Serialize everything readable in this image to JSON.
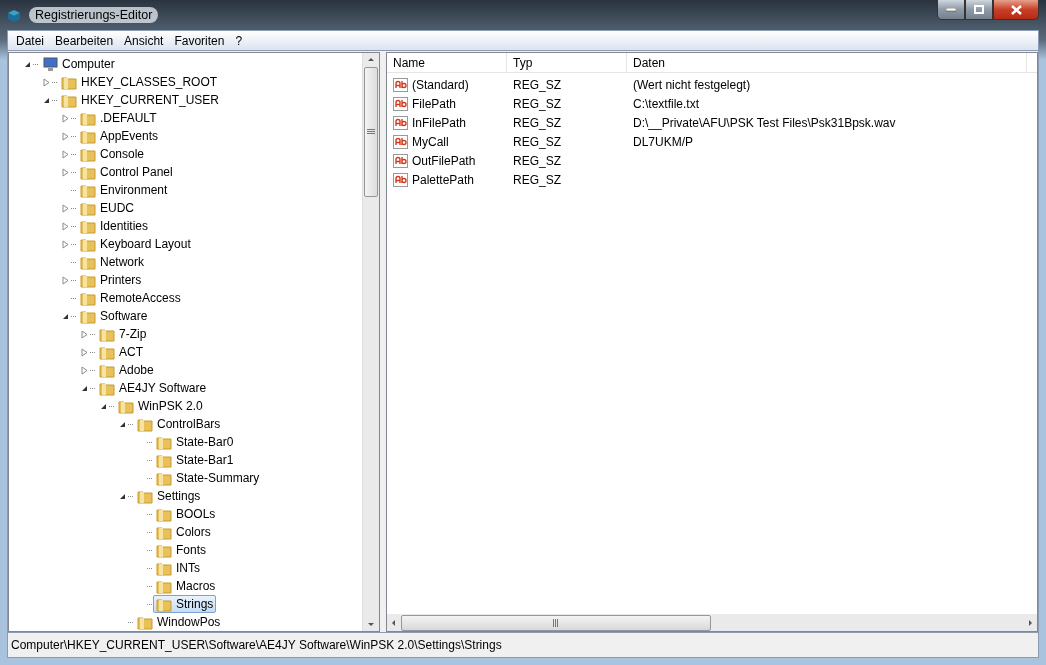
{
  "window": {
    "title": "Registrierungs-Editor"
  },
  "menu": [
    "Datei",
    "Bearbeiten",
    "Ansicht",
    "Favoriten",
    "?"
  ],
  "tree": [
    {
      "label": "Computer",
      "kind": "computer",
      "expanded": true,
      "selected": false,
      "children": [
        {
          "label": "HKEY_CLASSES_ROOT",
          "kind": "folder",
          "expanded": false,
          "selected": false
        },
        {
          "label": "HKEY_CURRENT_USER",
          "kind": "folder",
          "expanded": true,
          "selected": false,
          "children": [
            {
              "label": ".DEFAULT",
              "kind": "folder",
              "expanded": false,
              "selected": false
            },
            {
              "label": "AppEvents",
              "kind": "folder",
              "expanded": false,
              "selected": false
            },
            {
              "label": "Console",
              "kind": "folder",
              "expanded": false,
              "selected": false
            },
            {
              "label": "Control Panel",
              "kind": "folder",
              "expanded": false,
              "selected": false
            },
            {
              "label": "Environment",
              "kind": "folder",
              "selected": false
            },
            {
              "label": "EUDC",
              "kind": "folder",
              "expanded": false,
              "selected": false
            },
            {
              "label": "Identities",
              "kind": "folder",
              "expanded": false,
              "selected": false
            },
            {
              "label": "Keyboard Layout",
              "kind": "folder",
              "expanded": false,
              "selected": false
            },
            {
              "label": "Network",
              "kind": "folder",
              "selected": false
            },
            {
              "label": "Printers",
              "kind": "folder",
              "expanded": false,
              "selected": false
            },
            {
              "label": "RemoteAccess",
              "kind": "folder",
              "selected": false
            },
            {
              "label": "Software",
              "kind": "folder",
              "expanded": true,
              "selected": false,
              "children": [
                {
                  "label": "7-Zip",
                  "kind": "folder",
                  "expanded": false,
                  "selected": false
                },
                {
                  "label": "ACT",
                  "kind": "folder",
                  "expanded": false,
                  "selected": false
                },
                {
                  "label": "Adobe",
                  "kind": "folder",
                  "expanded": false,
                  "selected": false
                },
                {
                  "label": "AE4JY Software",
                  "kind": "folder",
                  "expanded": true,
                  "selected": false,
                  "children": [
                    {
                      "label": "WinPSK 2.0",
                      "kind": "folder",
                      "expanded": true,
                      "selected": false,
                      "children": [
                        {
                          "label": "ControlBars",
                          "kind": "folder",
                          "expanded": true,
                          "selected": false,
                          "children": [
                            {
                              "label": "State-Bar0",
                              "kind": "folder",
                              "selected": false
                            },
                            {
                              "label": "State-Bar1",
                              "kind": "folder",
                              "selected": false
                            },
                            {
                              "label": "State-Summary",
                              "kind": "folder",
                              "selected": false
                            }
                          ]
                        },
                        {
                          "label": "Settings",
                          "kind": "folder",
                          "expanded": true,
                          "selected": false,
                          "children": [
                            {
                              "label": "BOOLs",
                              "kind": "folder",
                              "selected": false
                            },
                            {
                              "label": "Colors",
                              "kind": "folder",
                              "selected": false
                            },
                            {
                              "label": "Fonts",
                              "kind": "folder",
                              "selected": false
                            },
                            {
                              "label": "INTs",
                              "kind": "folder",
                              "selected": false
                            },
                            {
                              "label": "Macros",
                              "kind": "folder",
                              "selected": false
                            },
                            {
                              "label": "Strings",
                              "kind": "folder",
                              "selected": true
                            }
                          ]
                        },
                        {
                          "label": "WindowPos",
                          "kind": "folder",
                          "selected": false
                        }
                      ]
                    }
                  ]
                }
              ]
            }
          ]
        }
      ]
    }
  ],
  "list": {
    "columns": [
      "Name",
      "Typ",
      "Daten"
    ],
    "rows": [
      {
        "name": "(Standard)",
        "type": "REG_SZ",
        "data": "(Wert nicht festgelegt)"
      },
      {
        "name": "FilePath",
        "type": "REG_SZ",
        "data": "C:\\textfile.txt"
      },
      {
        "name": "InFilePath",
        "type": "REG_SZ",
        "data": "D:\\__Private\\AFU\\PSK Test Files\\Psk31Bpsk.wav"
      },
      {
        "name": "MyCall",
        "type": "REG_SZ",
        "data": "DL7UKM/P"
      },
      {
        "name": "OutFilePath",
        "type": "REG_SZ"
      },
      {
        "name": "PalettePath",
        "type": "REG_SZ"
      }
    ]
  },
  "status_bar": "Computer\\HKEY_CURRENT_USER\\Software\\AE4JY Software\\WinPSK 2.0\\Settings\\Strings"
}
